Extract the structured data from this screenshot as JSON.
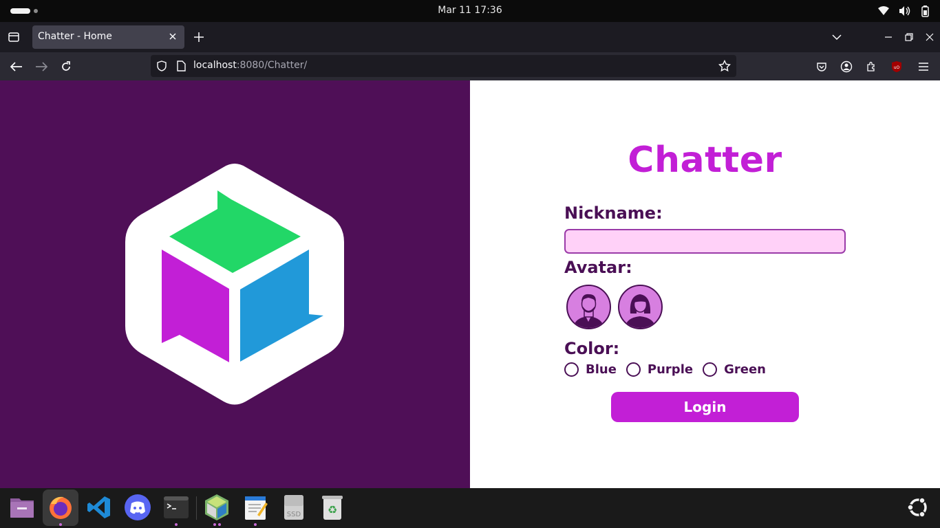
{
  "system": {
    "clock": "Mar 11  17:36"
  },
  "browser": {
    "tab_title": "Chatter - Home",
    "url_host": "localhost",
    "url_path": ":8080/Chatter/"
  },
  "page": {
    "app_title": "Chatter",
    "nickname_label": "Nickname:",
    "nickname_value": "",
    "avatar_label": "Avatar:",
    "avatars": [
      "male-avatar",
      "female-avatar"
    ],
    "color_label": "Color:",
    "color_options": [
      "Blue",
      "Purple",
      "Green"
    ],
    "login_label": "Login"
  },
  "colors": {
    "left_panel_bg": "#4f0f57",
    "brand": "#c21fd6",
    "text_dark": "#4a0f55",
    "input_bg": "#ffd1f8",
    "logo_green": "#22d767",
    "logo_purple": "#c21fd6",
    "logo_blue": "#2199d9"
  },
  "dock": {
    "apps": [
      "files-icon",
      "firefox-icon",
      "vscode-icon",
      "discord-icon",
      "terminal-icon",
      "netbeans-icon",
      "text-editor-icon",
      "ssd-drive-icon",
      "trash-icon"
    ],
    "ssd_label": "SSD"
  }
}
